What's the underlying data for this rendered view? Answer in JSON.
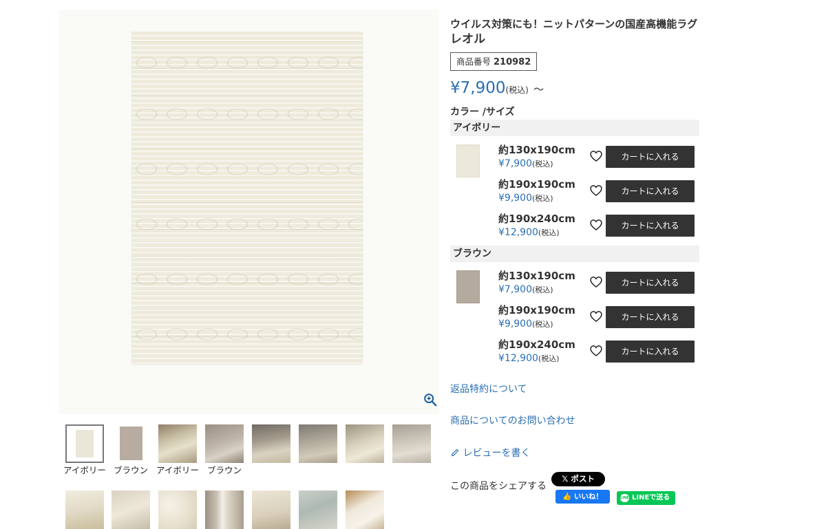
{
  "product": {
    "title_main": "ウイルス対策にも！ニットパターンの国産高機能ラグ",
    "title_name": "レオル",
    "code_label": "商品番号",
    "code_value": "210982",
    "price": "¥7,900",
    "tax_label": "(税込)",
    "price_suffix": "～"
  },
  "options": {
    "section_label": "カラー /サイズ",
    "colors": [
      {
        "name": "アイボリー",
        "swatch_color": "#ece8da",
        "sizes": [
          {
            "size": "約130x190cm",
            "price": "¥7,900",
            "tax": "(税込)",
            "button": "カートに入れる"
          },
          {
            "size": "約190x190cm",
            "price": "¥9,900",
            "tax": "(税込)",
            "button": "カートに入れる"
          },
          {
            "size": "約190x240cm",
            "price": "¥12,900",
            "tax": "(税込)",
            "button": "カートに入れる"
          }
        ]
      },
      {
        "name": "ブラウン",
        "swatch_color": "#b5aa9e",
        "sizes": [
          {
            "size": "約130x190cm",
            "price": "¥7,900",
            "tax": "(税込)",
            "button": "カートに入れる"
          },
          {
            "size": "約190x190cm",
            "price": "¥9,900",
            "tax": "(税込)",
            "button": "カートに入れる"
          },
          {
            "size": "約190x240cm",
            "price": "¥12,900",
            "tax": "(税込)",
            "button": "カートに入れる"
          }
        ]
      }
    ]
  },
  "links": {
    "returns": "返品特約について",
    "inquiry": "商品についてのお問い合わせ",
    "review": "レビューを書く"
  },
  "share": {
    "label": "この商品をシェアする",
    "x_post": "ポスト",
    "fb_like": "いいね！",
    "line_send": "LINEで送る",
    "line_logo_text": "LINE"
  },
  "thumbnails": {
    "captions": [
      "アイボリー",
      "ブラウン",
      "アイボリー",
      "ブラウン"
    ]
  },
  "colors": {
    "accent_blue": "#2a6fb3",
    "button_dark": "#333333",
    "facebook": "#1877f2",
    "line": "#06c755"
  }
}
